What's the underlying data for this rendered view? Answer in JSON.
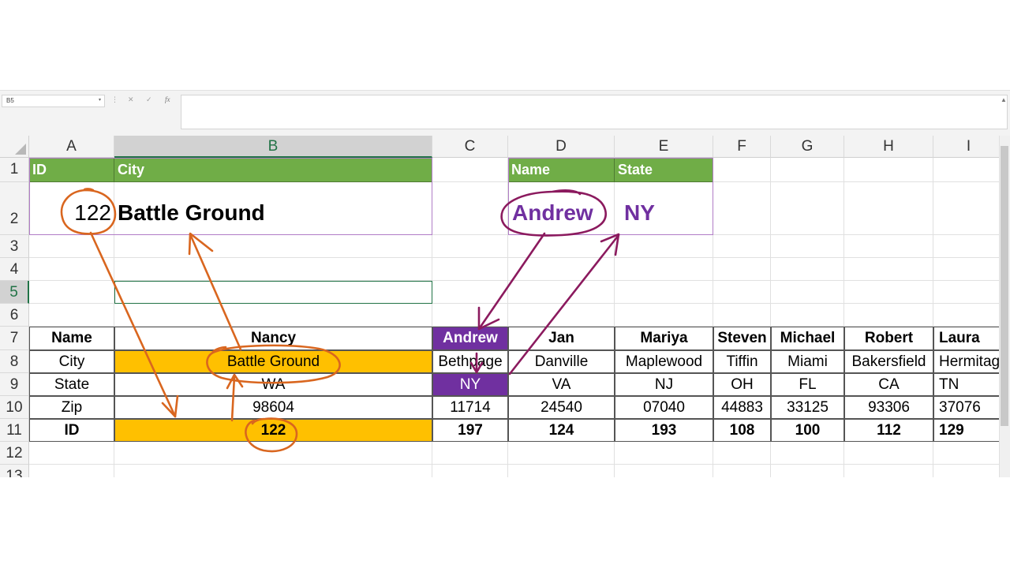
{
  "formula_bar": {
    "name_box": "B5",
    "dropdown_glyph": "▾",
    "cancel_glyph": "✕",
    "enter_glyph": "✓",
    "fx_label": "fx",
    "separator": "⋮",
    "scroll_up": "▲",
    "formula": ""
  },
  "columns": [
    "A",
    "B",
    "C",
    "D",
    "E",
    "F",
    "G",
    "H",
    "I"
  ],
  "rows": [
    "1",
    "2",
    "3",
    "4",
    "5",
    "6",
    "7",
    "8",
    "9",
    "10",
    "11",
    "12",
    "13"
  ],
  "selected_cell": "B5",
  "lookup_1": {
    "id_header": "ID",
    "city_header": "City",
    "id_value": "122",
    "city_value": "Battle Ground"
  },
  "lookup_2": {
    "name_header": "Name",
    "state_header": "State",
    "name_value": "Andrew",
    "state_value": "NY"
  },
  "table": {
    "row_labels": [
      "Name",
      "City",
      "State",
      "Zip",
      "ID"
    ],
    "people": [
      {
        "name": "Nancy",
        "city": "Battle Ground",
        "state": "WA",
        "zip": "98604",
        "id": "122"
      },
      {
        "name": "Andrew",
        "city": "Bethpage",
        "state": "NY",
        "zip": "11714",
        "id": "197"
      },
      {
        "name": "Jan",
        "city": "Danville",
        "state": "VA",
        "zip": "24540",
        "id": "124"
      },
      {
        "name": "Mariya",
        "city": "Maplewood",
        "state": "NJ",
        "zip": "07040",
        "id": "193"
      },
      {
        "name": "Steven",
        "city": "Tiffin",
        "state": "OH",
        "zip": "44883",
        "id": "108"
      },
      {
        "name": "Michael",
        "city": "Miami",
        "state": "FL",
        "zip": "33125",
        "id": "100"
      },
      {
        "name": "Robert",
        "city": "Bakersfield",
        "state": "CA",
        "zip": "93306",
        "id": "112"
      },
      {
        "name": "Laura",
        "city": "Hermitage",
        "state": "TN",
        "zip": "37076",
        "id": "129"
      }
    ]
  },
  "colors": {
    "header_green": "#70ad47",
    "highlight_orange": "#ffc000",
    "highlight_purple": "#7030a0",
    "annotation_orange": "#d9661f",
    "annotation_purple": "#8b1a5e",
    "selection_green": "#217346"
  }
}
